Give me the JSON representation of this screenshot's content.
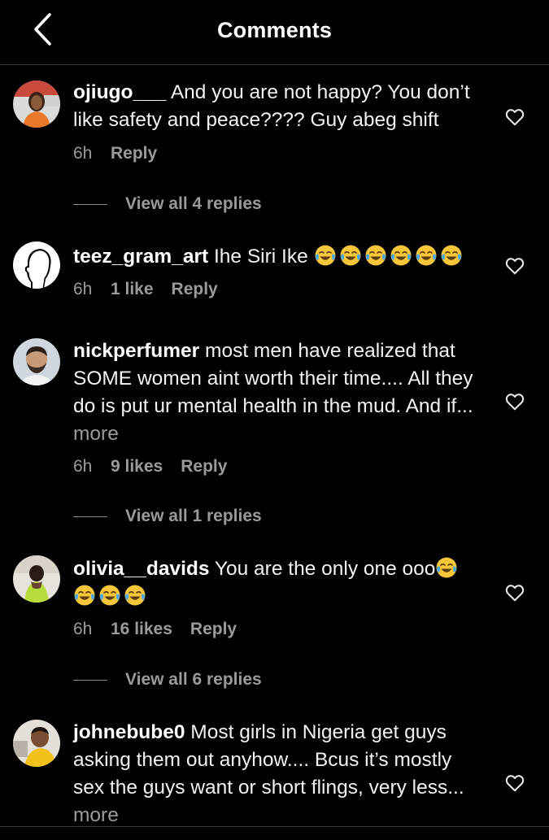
{
  "header": {
    "title": "Comments",
    "back_icon": "chevron-left-icon"
  },
  "comments": [
    {
      "username": "ojiugo___",
      "text": "And you are not happy? You don’t like safety and peace???? Guy abeg shift",
      "time": "6h",
      "likes": "",
      "reply": "Reply",
      "view_replies": "View all 4 replies"
    },
    {
      "username": "teez_gram_art",
      "text": "Ihe Siri Ike",
      "emoji_count": 6,
      "emoji": "face-with-tears-of-joy",
      "time": "6h",
      "likes": "1 like",
      "reply": "Reply"
    },
    {
      "username": "nickperfumer",
      "text": "most men have realized that SOME women aint worth their time.... All they do is put ur mental health in the mud. And if...",
      "more": "more",
      "time": "6h",
      "likes": "9 likes",
      "reply": "Reply",
      "view_replies": "View all 1 replies"
    },
    {
      "username": "olivia__davids",
      "text": "You are the only one ooo",
      "emoji_count": 4,
      "emoji": "face-with-tears-of-joy",
      "time": "6h",
      "likes": "16 likes",
      "reply": "Reply",
      "view_replies": "View all 6 replies"
    },
    {
      "username": "johnebube0",
      "text": "Most girls in Nigeria get guys asking them out anyhow.... Bcus it’s mostly sex the guys want or short flings, very less...",
      "more": "more"
    }
  ],
  "colors": {
    "background": "#000000",
    "text": "#f2f2f2",
    "secondary": "#9a9a9a",
    "divider": "#363636",
    "emoji_face": "#f7c63b",
    "emoji_tear": "#4aa8e8"
  }
}
